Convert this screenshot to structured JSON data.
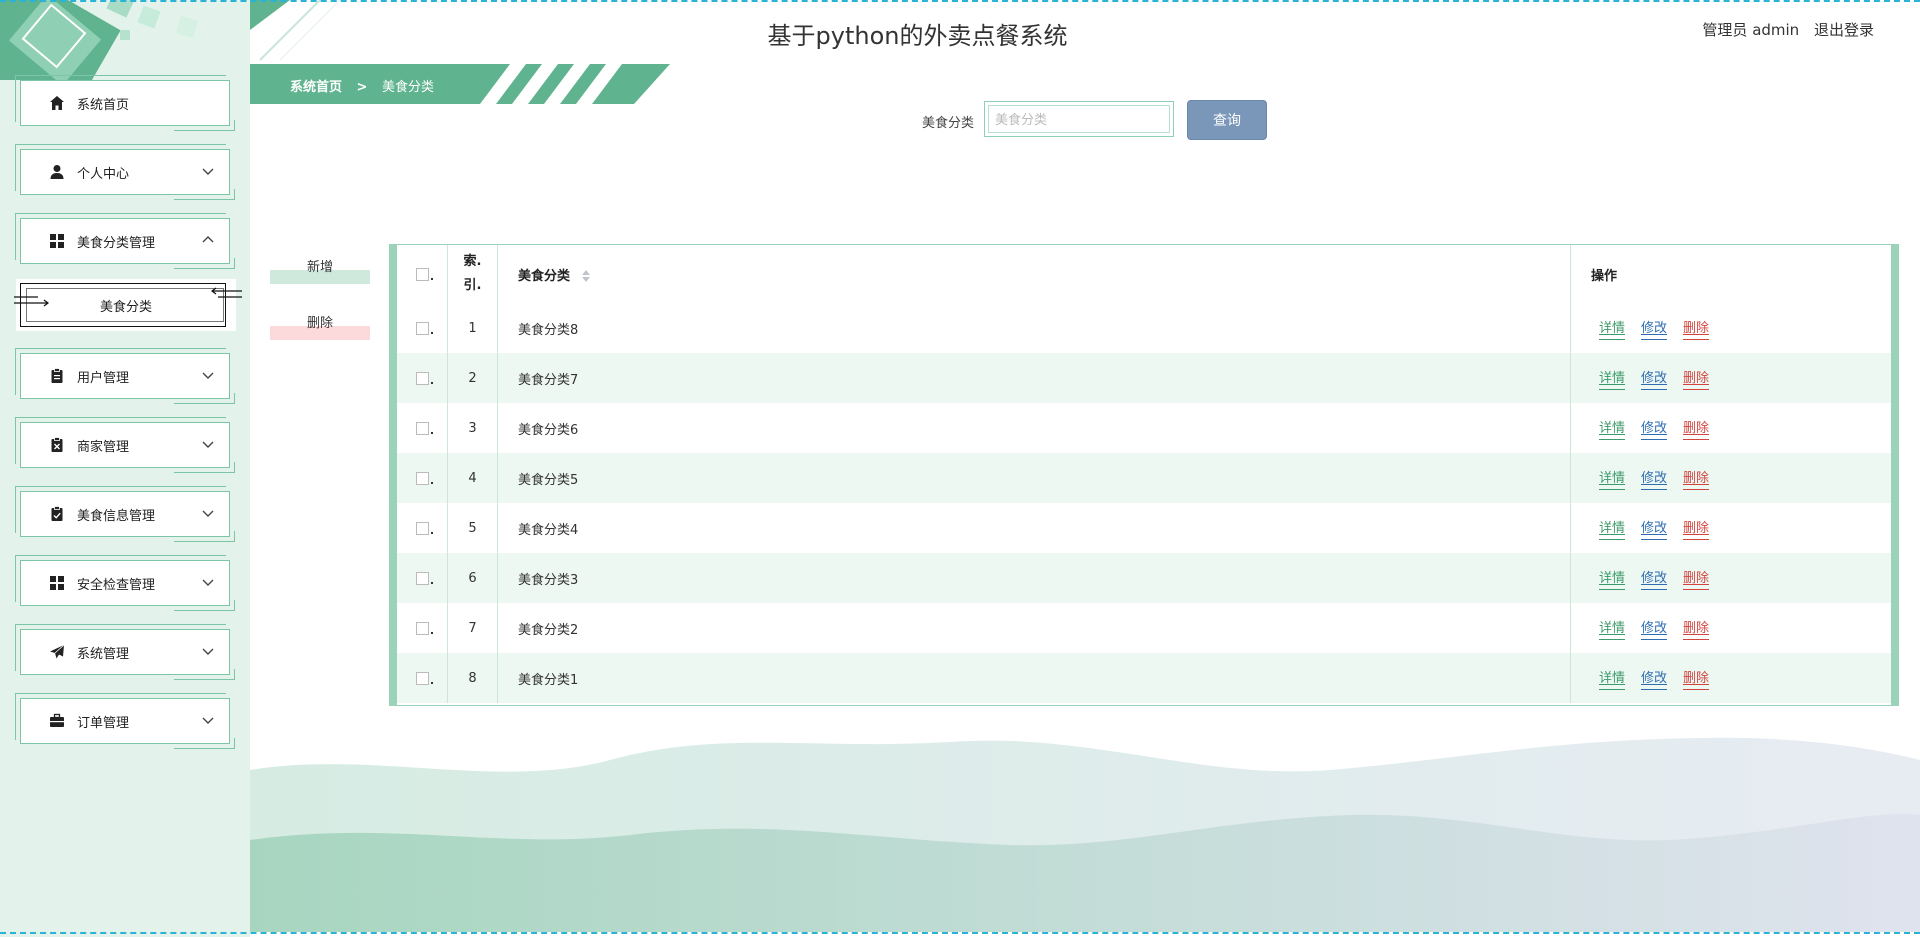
{
  "header": {
    "title": "基于python的外卖点餐系统",
    "user_label": "管理员 admin",
    "logout_label": "退出登录"
  },
  "breadcrumb": {
    "home": "系统首页",
    "separator": ">",
    "current": "美食分类"
  },
  "sidebar": {
    "items": [
      {
        "label": "系统首页",
        "icon": "home-icon"
      },
      {
        "label": "个人中心",
        "icon": "user-icon"
      },
      {
        "label": "美食分类管理",
        "icon": "grid-icon",
        "expanded": true,
        "sub": "美食分类"
      },
      {
        "label": "用户管理",
        "icon": "clipboard-icon"
      },
      {
        "label": "商家管理",
        "icon": "clipboard-x-icon"
      },
      {
        "label": "美食信息管理",
        "icon": "clipboard-check-icon"
      },
      {
        "label": "安全检查管理",
        "icon": "grid-icon"
      },
      {
        "label": "系统管理",
        "icon": "send-icon"
      },
      {
        "label": "订单管理",
        "icon": "briefcase-icon"
      }
    ]
  },
  "search": {
    "label": "美食分类",
    "placeholder": "美食分类",
    "value": "",
    "button": "查询"
  },
  "actions": {
    "add": "新增",
    "delete": "删除"
  },
  "table": {
    "headers": {
      "index_line1": "索.",
      "index_line2": "引.",
      "name": "美食分类",
      "ops": "操作"
    },
    "rows": [
      {
        "index": "1",
        "name": "美食分类8"
      },
      {
        "index": "2",
        "name": "美食分类7"
      },
      {
        "index": "3",
        "name": "美食分类6"
      },
      {
        "index": "4",
        "name": "美食分类5"
      },
      {
        "index": "5",
        "name": "美食分类4"
      },
      {
        "index": "6",
        "name": "美食分类3"
      },
      {
        "index": "7",
        "name": "美食分类2"
      },
      {
        "index": "8",
        "name": "美食分类1"
      }
    ],
    "op_labels": {
      "detail": "详情",
      "edit": "修改",
      "delete": "删除"
    }
  },
  "colors": {
    "primary": "#5fb38f",
    "sidebar_bg": "#e3f3ec",
    "detail": "#3d9a6a",
    "edit": "#2f6db2",
    "delete": "#d2453f",
    "query_btn": "#7a97ba"
  }
}
